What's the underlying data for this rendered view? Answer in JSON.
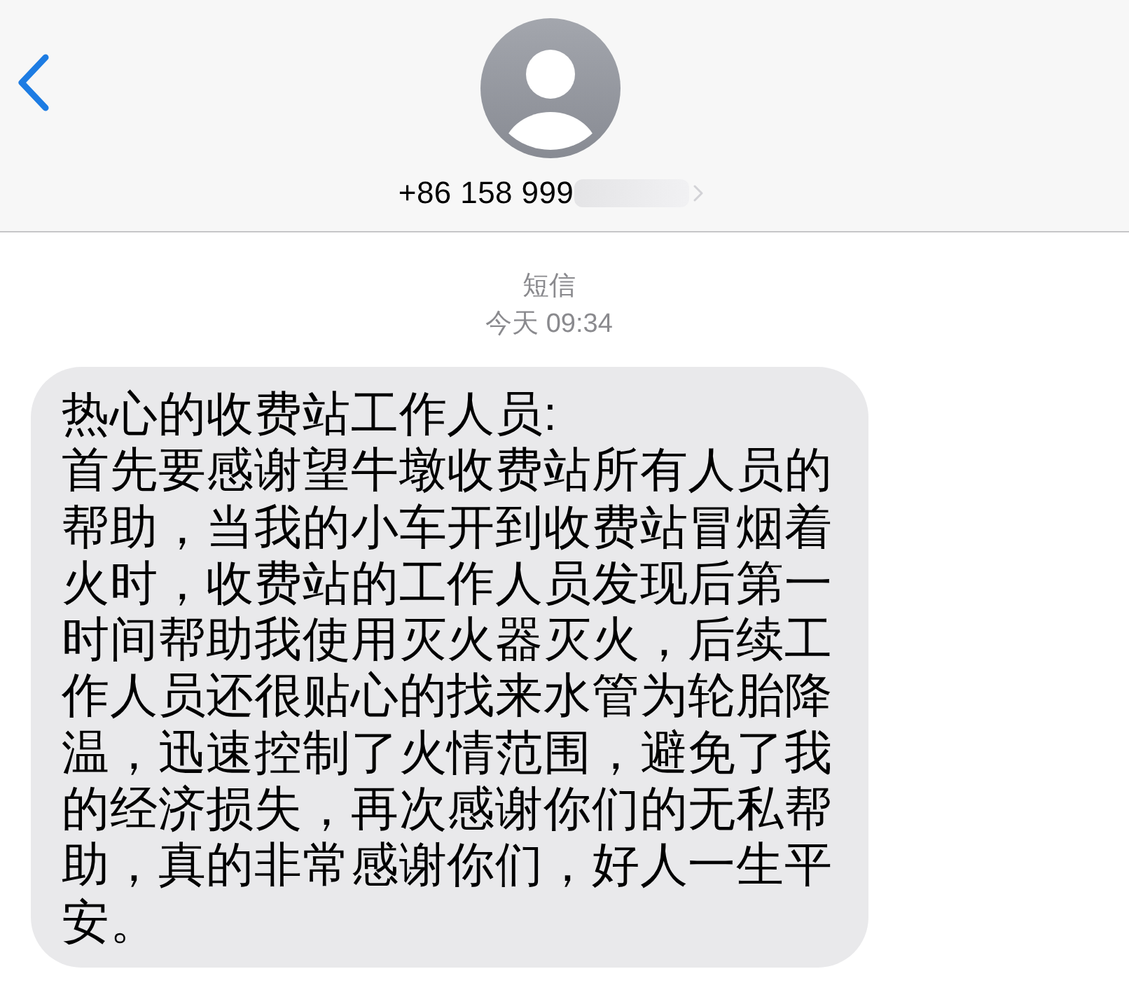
{
  "nav_bar": {
    "contact_number": "+86 158 999",
    "number_redacted": true
  },
  "conversation": {
    "service": "短信",
    "timestamp": "今天 09:34",
    "messages": [
      {
        "kind": "incoming",
        "text": "热心的收费站工作人员:\n首先要感谢望牛墩收费站所有人员的帮助，当我的小车开到收费站冒烟着火时，收费站的工作人员发现后第一时间帮助我使用灭火器灭火，后续工作人员还很贴心的找来水管为轮胎降温，迅速控制了火情范围，避免了我的经济损失，再次感谢你们的无私帮助，真的非常感谢你们，好人一生平安。"
      }
    ]
  }
}
